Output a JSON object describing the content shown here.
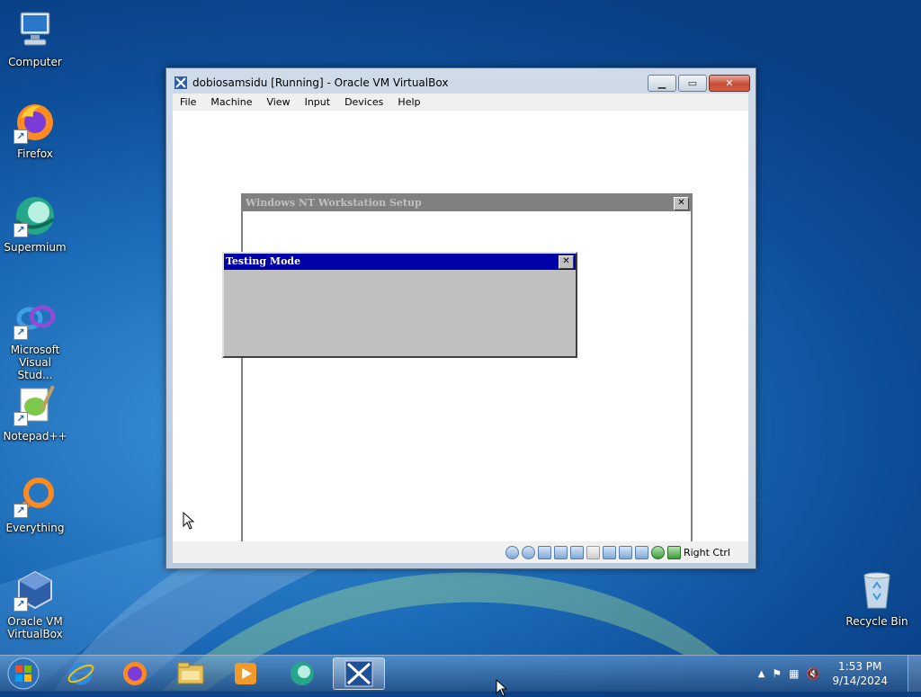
{
  "desktop": {
    "icons": [
      {
        "label": "Computer"
      },
      {
        "label": "Firefox"
      },
      {
        "label": "Supermium"
      },
      {
        "label": "Microsoft Visual Stud..."
      },
      {
        "label": "Notepad++"
      },
      {
        "label": "Everything"
      },
      {
        "label": "Oracle VM VirtualBox"
      },
      {
        "label": "Recycle Bin"
      }
    ]
  },
  "vbox": {
    "title": "dobiosamsidu [Running] - Oracle VM VirtualBox",
    "menu": [
      "File",
      "Machine",
      "View",
      "Input",
      "Devices",
      "Help"
    ],
    "host_key": "Right Ctrl",
    "status_icons": [
      "hard-disk-icon",
      "optical-drive-icon",
      "audio-icon",
      "network-icon",
      "usb-icon",
      "shared-folder-icon",
      "display-icon",
      "recording-icon",
      "cpu-icon",
      "guest-additions-icon",
      "mouse-integration-icon"
    ]
  },
  "guest": {
    "setup_title": "Windows NT Workstation Setup",
    "dialog_title": "Testing Mode"
  },
  "taskbar": {
    "time": "1:53 PM",
    "date": "9/14/2024",
    "apps": [
      "internet-explorer-icon",
      "firefox-icon",
      "file-explorer-icon",
      "media-player-icon",
      "supermium-icon",
      "virtualbox-vm-icon"
    ]
  }
}
